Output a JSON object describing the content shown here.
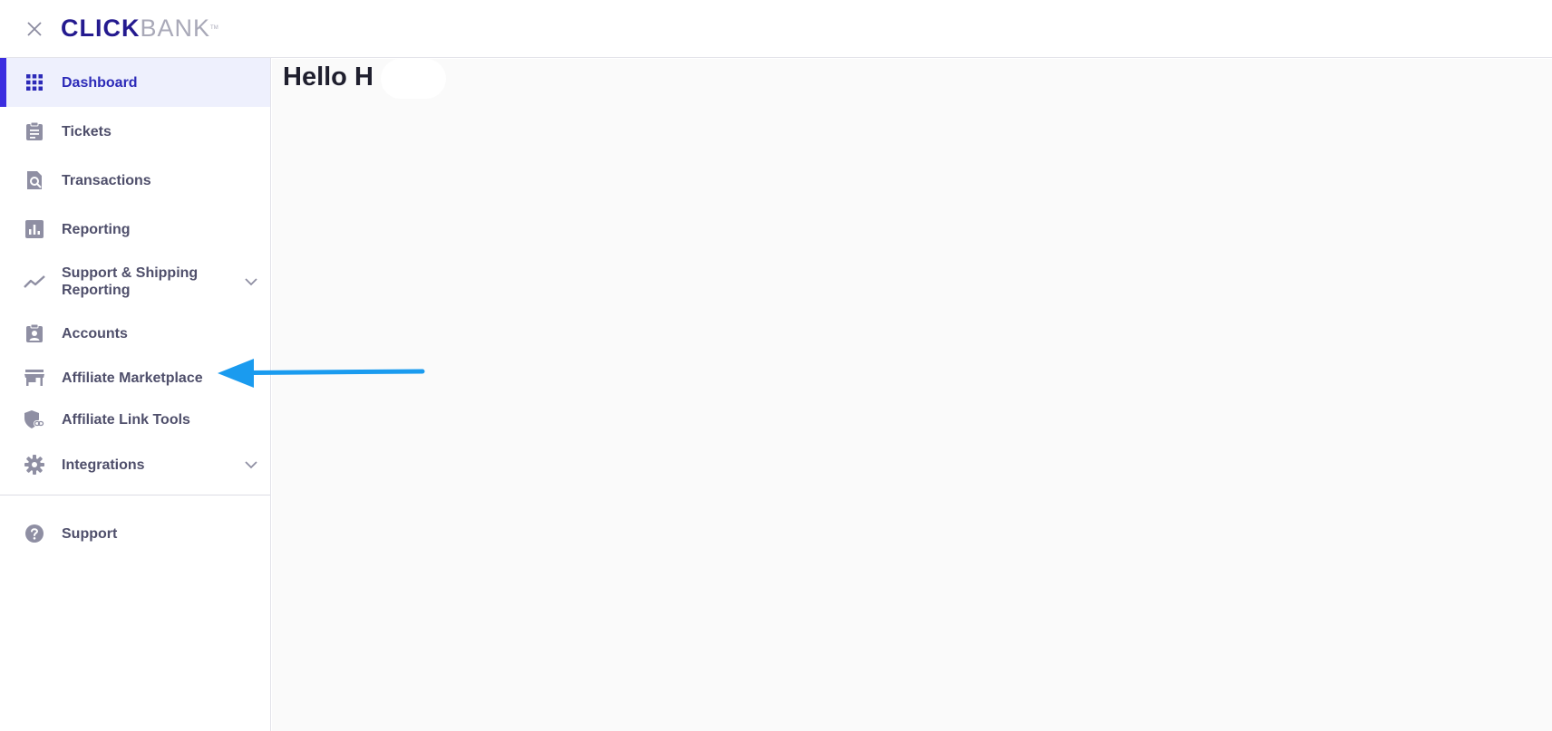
{
  "header": {
    "logo_primary": "CLICK",
    "logo_secondary": "BANK",
    "logo_tm": "TM"
  },
  "sidebar": {
    "items": [
      {
        "label": "Dashboard",
        "icon": "grid-icon"
      },
      {
        "label": "Tickets",
        "icon": "clipboard-icon"
      },
      {
        "label": "Transactions",
        "icon": "document-search-icon"
      },
      {
        "label": "Reporting",
        "icon": "bar-chart-icon"
      },
      {
        "label": "Support & Shipping Reporting",
        "icon": "trend-line-icon"
      },
      {
        "label": "Accounts",
        "icon": "contact-badge-icon"
      },
      {
        "label": "Affiliate Marketplace",
        "icon": "storefront-icon"
      },
      {
        "label": "Affiliate Link Tools",
        "icon": "shield-link-icon"
      },
      {
        "label": "Integrations",
        "icon": "gear-icon"
      }
    ],
    "support": {
      "label": "Support",
      "icon": "help-circle-icon"
    }
  },
  "main": {
    "greeting": "Hello H"
  },
  "colors": {
    "accent": "#3b2de0",
    "active_bg": "#eef0fd",
    "arrow": "#1a9bef"
  }
}
